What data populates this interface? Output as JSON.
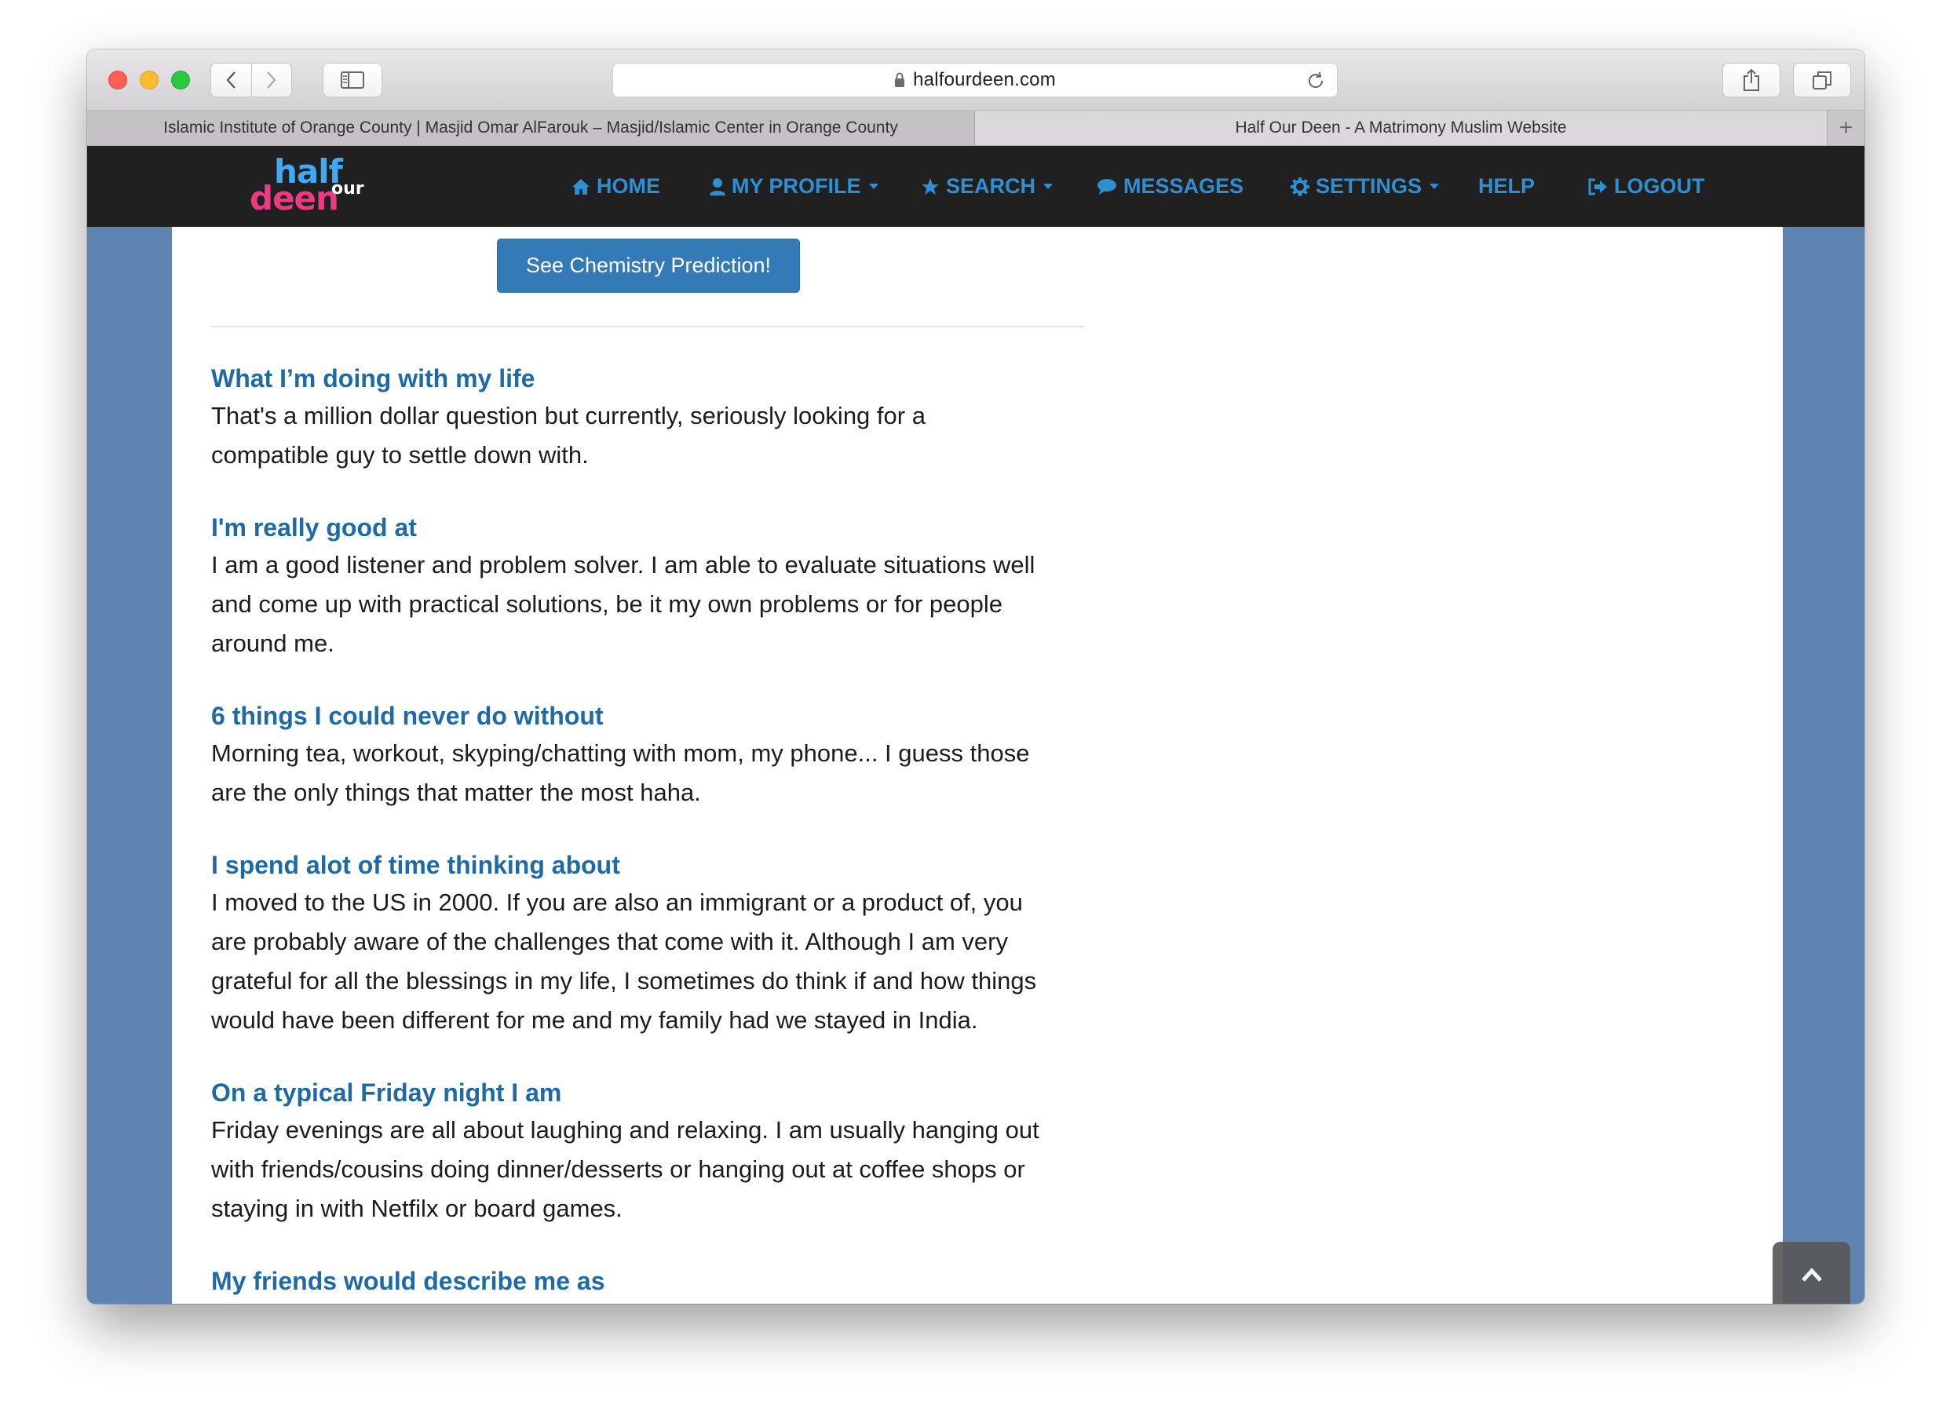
{
  "browser": {
    "url": "halfourdeen.com",
    "tabs": [
      {
        "title": "Islamic Institute of Orange County | Masjid Omar AlFarouk – Masjid/Islamic Center in Orange County",
        "active": false
      },
      {
        "title": "Half Our Deen - A Matrimony Muslim Website",
        "active": true
      }
    ],
    "new_tab_symbol": "+"
  },
  "site": {
    "logo": {
      "half": "half",
      "deen": "deen",
      "our": "our"
    },
    "nav": [
      {
        "label": "HOME",
        "icon": "home-icon",
        "dropdown": false
      },
      {
        "label": "MY PROFILE",
        "icon": "user-icon",
        "dropdown": true
      },
      {
        "label": "SEARCH",
        "icon": "star-icon",
        "dropdown": true
      },
      {
        "label": "MESSAGES",
        "icon": "comment-icon",
        "dropdown": false
      },
      {
        "label": "SETTINGS",
        "icon": "gear-icon",
        "dropdown": true
      },
      {
        "label": "HELP",
        "icon": "",
        "dropdown": false
      },
      {
        "label": "LOGOUT",
        "icon": "logout-icon",
        "dropdown": false
      }
    ],
    "colors": {
      "nav_bg": "#202020",
      "nav_link": "#2f8fd3",
      "heading": "#1f6aa5",
      "side_bg": "#6084b2",
      "button": "#337ab7"
    }
  },
  "profile": {
    "chemistry_button": "See Chemistry Prediction!",
    "sections": [
      {
        "heading": "What I’m doing with my life",
        "lines": [
          "That's a million dollar question but currently, seriously looking for a",
          "compatible guy to settle down with."
        ]
      },
      {
        "heading": "I'm really good at",
        "lines": [
          "I am a good listener and problem solver. I am able to evaluate situations well",
          "and come up with practical solutions, be it my own problems or for people",
          "around me."
        ]
      },
      {
        "heading": "6 things I could never do without",
        "lines": [
          "Morning tea, workout, skyping/chatting with mom, my phone... I guess those",
          "are the only things that matter the most haha."
        ]
      },
      {
        "heading": "I spend alot of time thinking about",
        "lines": [
          "I moved to the US in 2000. If you are also an immigrant or a product of, you",
          "are probably aware of the challenges that come with it. Although I am very",
          "grateful for all the blessings in my life, I sometimes do think if and how things",
          "would have been different for me and my family had we stayed in India."
        ]
      },
      {
        "heading": "On a typical Friday night I am",
        "lines": [
          "Friday evenings are all about laughing and relaxing. I am usually hanging out",
          "with friends/cousins doing dinner/desserts or hanging out at coffee shops or",
          "staying in with Netfilx or board games."
        ]
      },
      {
        "heading": "My friends would describe me as",
        "lines": []
      }
    ]
  }
}
